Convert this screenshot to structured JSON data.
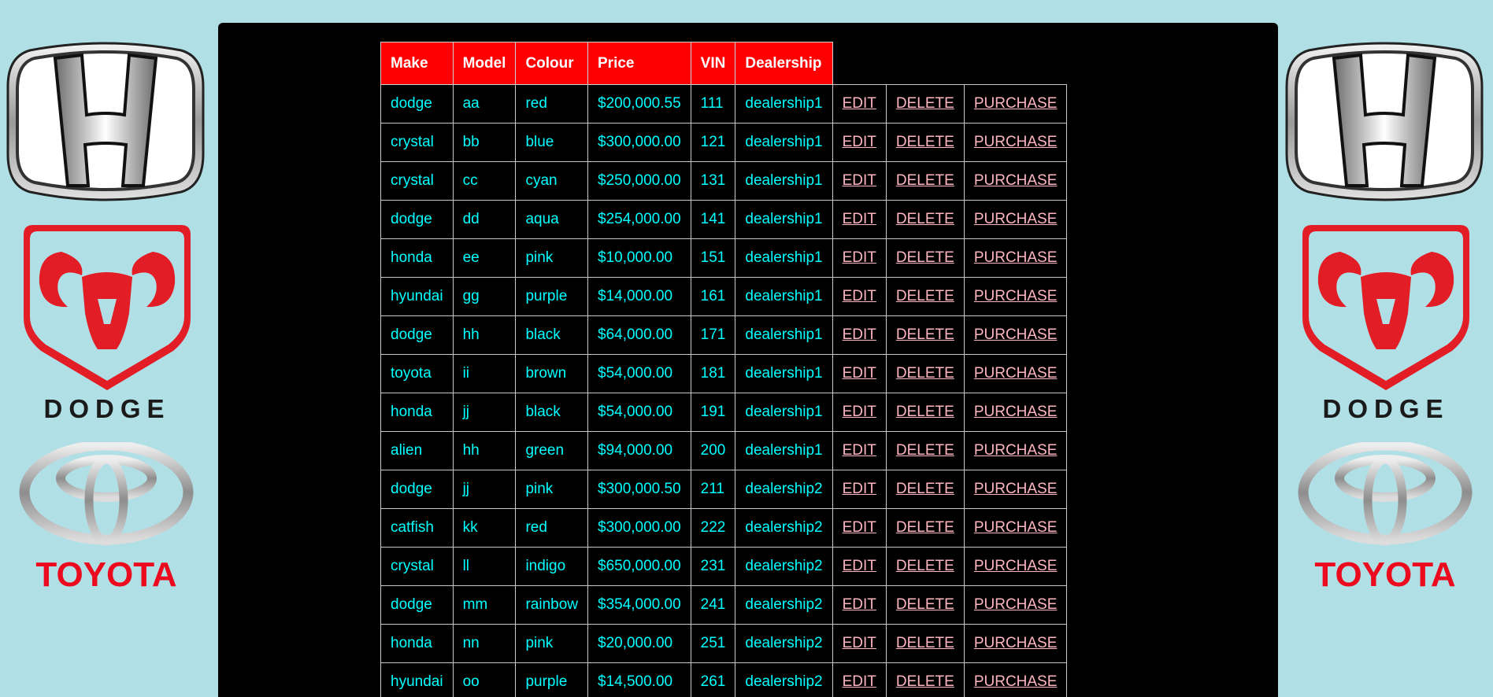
{
  "logos": {
    "honda": "honda-logo",
    "dodge": "DODGE",
    "toyota": "TOYOTA"
  },
  "table": {
    "headers": [
      "Make",
      "Model",
      "Colour",
      "Price",
      "VIN",
      "Dealership"
    ],
    "actions": {
      "edit": "EDIT",
      "delete": "DELETE",
      "purchase": "PURCHASE"
    },
    "rows": [
      [
        "dodge",
        "aa",
        "red",
        "$200,000.55",
        "111",
        "dealership1"
      ],
      [
        "crystal",
        "bb",
        "blue",
        "$300,000.00",
        "121",
        "dealership1"
      ],
      [
        "crystal",
        "cc",
        "cyan",
        "$250,000.00",
        "131",
        "dealership1"
      ],
      [
        "dodge",
        "dd",
        "aqua",
        "$254,000.00",
        "141",
        "dealership1"
      ],
      [
        "honda",
        "ee",
        "pink",
        "$10,000.00",
        "151",
        "dealership1"
      ],
      [
        "hyundai",
        "gg",
        "purple",
        "$14,000.00",
        "161",
        "dealership1"
      ],
      [
        "dodge",
        "hh",
        "black",
        "$64,000.00",
        "171",
        "dealership1"
      ],
      [
        "toyota",
        "ii",
        "brown",
        "$54,000.00",
        "181",
        "dealership1"
      ],
      [
        "honda",
        "jj",
        "black",
        "$54,000.00",
        "191",
        "dealership1"
      ],
      [
        "alien",
        "hh",
        "green",
        "$94,000.00",
        "200",
        "dealership1"
      ],
      [
        "dodge",
        "jj",
        "pink",
        "$300,000.50",
        "211",
        "dealership2"
      ],
      [
        "catfish",
        "kk",
        "red",
        "$300,000.00",
        "222",
        "dealership2"
      ],
      [
        "crystal",
        "ll",
        "indigo",
        "$650,000.00",
        "231",
        "dealership2"
      ],
      [
        "dodge",
        "mm",
        "rainbow",
        "$354,000.00",
        "241",
        "dealership2"
      ],
      [
        "honda",
        "nn",
        "pink",
        "$20,000.00",
        "251",
        "dealership2"
      ],
      [
        "hyundai",
        "oo",
        "purple",
        "$14,500.00",
        "261",
        "dealership2"
      ]
    ]
  },
  "colors": {
    "page_bg": "#b0e0e6",
    "panel_bg": "#000000",
    "header_bg": "#ff0000",
    "cell_text": "#00ffff",
    "link_text": "#ffb6c1",
    "dodge_red": "#e31d25",
    "toyota_red": "#eb0a1e"
  }
}
